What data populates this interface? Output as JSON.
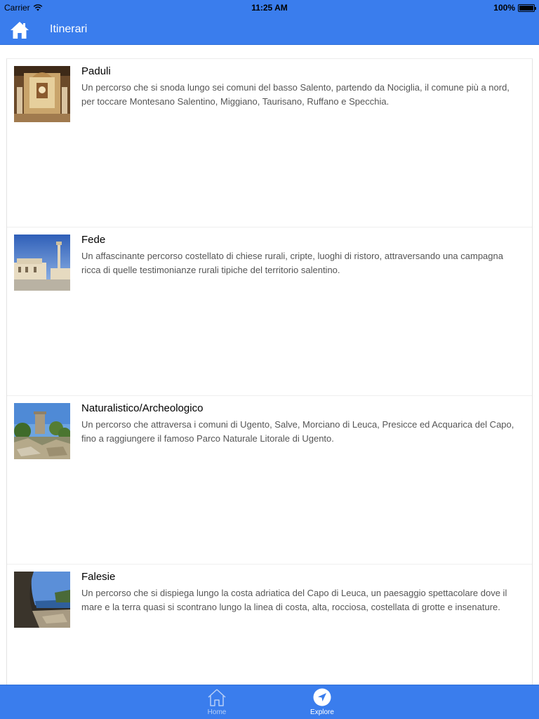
{
  "status_bar": {
    "carrier": "Carrier",
    "time": "11:25 AM",
    "battery": "100%",
    "battery_level": 1.0
  },
  "nav": {
    "title": "Itinerari",
    "home_icon": "home-icon"
  },
  "itineraries": [
    {
      "name": "Paduli",
      "description": "Un percorso che si snoda lungo sei comuni del basso Salento, partendo da Nociglia, il comune più a nord, per toccare Montesano Salentino, Miggiano, Taurisano, Ruffano e Specchia."
    },
    {
      "name": "Fede",
      "description": "Un affascinante percorso costellato di chiese rurali, cripte, luoghi di ristoro, attraversando una campagna ricca di quelle testimonianze rurali tipiche del territorio salentino."
    },
    {
      "name": "Naturalistico/Archeologico",
      "description": "Un percorso che attraversa i comuni di Ugento, Salve, Morciano di Leuca, Presicce ed Acquarica del Capo, fino a raggiungere il famoso Parco Naturale Litorale di Ugento."
    },
    {
      "name": "Falesie",
      "description": "Un percorso che si dispiega lungo la costa adriatica del Capo di Leuca, un paesaggio spettacolare dove il mare e la terra quasi si scontrano lungo la linea di costa, alta, rocciosa, costellata di grotte e insenature."
    }
  ],
  "tabbar": {
    "home_label": "Home",
    "explore_label": "Explore",
    "selected": "Explore"
  },
  "colors": {
    "bar": "#3a7ded",
    "tab_inactive": "#b8cff6",
    "tab_active": "#ffffff"
  }
}
